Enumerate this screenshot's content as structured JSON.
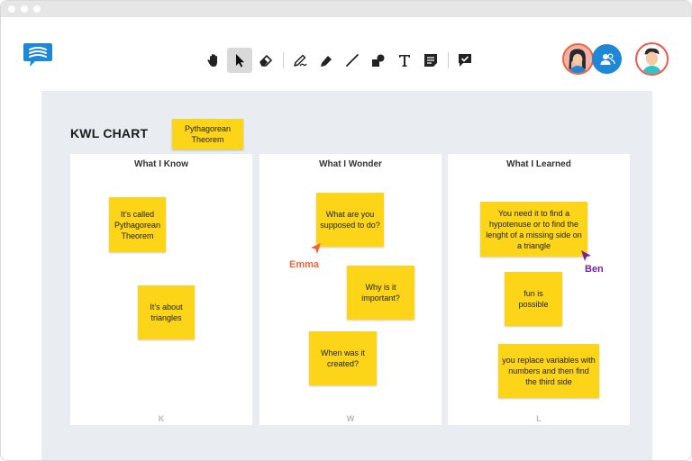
{
  "toolbar": {
    "tools": [
      {
        "icon": "hand-icon",
        "active": false
      },
      {
        "icon": "pointer-icon",
        "active": true
      },
      {
        "icon": "eraser-icon",
        "active": false
      },
      {
        "icon": "pen-icon",
        "active": false
      },
      {
        "icon": "highlighter-icon",
        "active": false
      },
      {
        "icon": "line-icon",
        "active": false
      },
      {
        "icon": "shapes-icon",
        "active": false
      },
      {
        "icon": "text-icon",
        "active": false
      },
      {
        "icon": "sticky-note-icon",
        "active": false
      },
      {
        "icon": "comment-check-icon",
        "active": false
      }
    ]
  },
  "board": {
    "title": "KWL CHART",
    "topic_note": "Pythagorean Theorem",
    "columns": [
      {
        "title": "What I Know",
        "letter": "K",
        "notes": [
          "It’s called Pythagorean Theorem",
          "It’s about triangles"
        ]
      },
      {
        "title": "What I Wonder",
        "letter": "W",
        "notes": [
          "What are you supposed to do?",
          "Why is it important?",
          "When was it created?"
        ]
      },
      {
        "title": "What I Learned",
        "letter": "L",
        "notes": [
          "You need it to find a hypotenuse or to find the lenght of a missing side on a triangle",
          "fun is possible",
          "you replace variables with numbers and then find the third side"
        ]
      }
    ]
  },
  "cursors": [
    {
      "name": "Emma",
      "color": "#f0643c"
    },
    {
      "name": "Ben",
      "color": "#7b1fa2"
    }
  ],
  "colors": {
    "accent_blue": "#1e88d6",
    "sticky_yellow": "#fcd519",
    "canvas_bg": "#e9edf1"
  }
}
